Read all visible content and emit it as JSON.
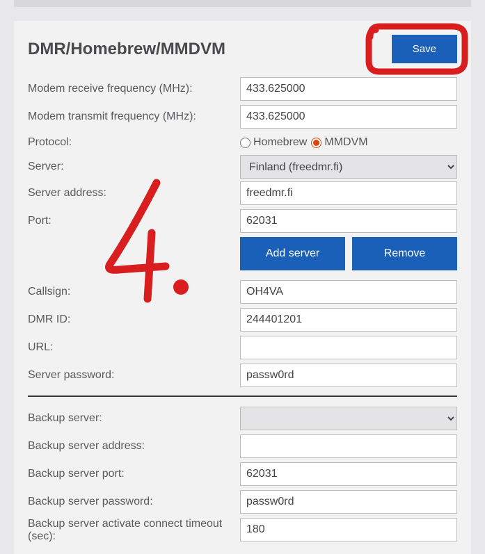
{
  "header": {
    "title": "DMR/Homebrew/MMDVM",
    "save_label": "Save"
  },
  "fields": {
    "rx_freq_label": "Modem receive frequency (MHz):",
    "rx_freq_value": "433.625000",
    "tx_freq_label": "Modem transmit frequency (MHz):",
    "tx_freq_value": "433.625000",
    "protocol_label": "Protocol:",
    "protocol_homebrew": "Homebrew",
    "protocol_mmdvm": "MMDVM",
    "server_label": "Server:",
    "server_selected": "Finland (freedmr.fi)",
    "server_addr_label": "Server address:",
    "server_addr_value": "freedmr.fi",
    "port_label": "Port:",
    "port_value": "62031",
    "add_server_label": "Add server",
    "remove_label": "Remove",
    "callsign_label": "Callsign:",
    "callsign_value": "OH4VA",
    "dmr_id_label": "DMR ID:",
    "dmr_id_value": "244401201",
    "url_label": "URL:",
    "url_value": "",
    "password_label": "Server password:",
    "password_value": "passw0rd",
    "backup_server_label": "Backup server:",
    "backup_server_selected": "",
    "backup_addr_label": "Backup server address:",
    "backup_addr_value": "",
    "backup_port_label": "Backup server port:",
    "backup_port_value": "62031",
    "backup_password_label": "Backup server password:",
    "backup_password_value": "passw0rd",
    "backup_timeout_label": "Backup server activate connect timeout (sec):",
    "backup_timeout_value": "180"
  },
  "annotation": {
    "number": "4.",
    "color": "#d81e1e"
  }
}
